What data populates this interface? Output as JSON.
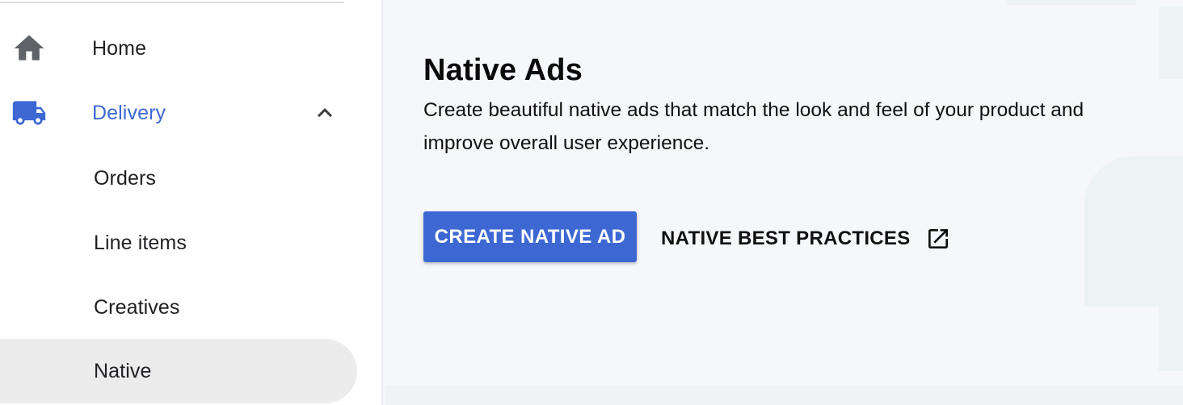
{
  "sidebar": {
    "items": [
      {
        "label": "Home",
        "icon": "home-icon"
      },
      {
        "label": "Delivery",
        "icon": "truck-icon",
        "expanded": true
      },
      {
        "label": "Orders"
      },
      {
        "label": "Line items"
      },
      {
        "label": "Creatives"
      },
      {
        "label": "Native",
        "selected": true
      }
    ]
  },
  "main": {
    "title": "Native Ads",
    "description": "Create beautiful native ads that match the look and feel of your product and improve overall user experience.",
    "primary_button": "CREATE NATIVE AD",
    "link_button": "NATIVE BEST PRACTICES",
    "link_icon": "open-in-new-icon"
  },
  "colors": {
    "accent": "#3d68d3",
    "icon_gray": "#5f6368",
    "selected_bg": "#ececec",
    "main_bg": "#f5f7fb",
    "text": "#202124"
  }
}
